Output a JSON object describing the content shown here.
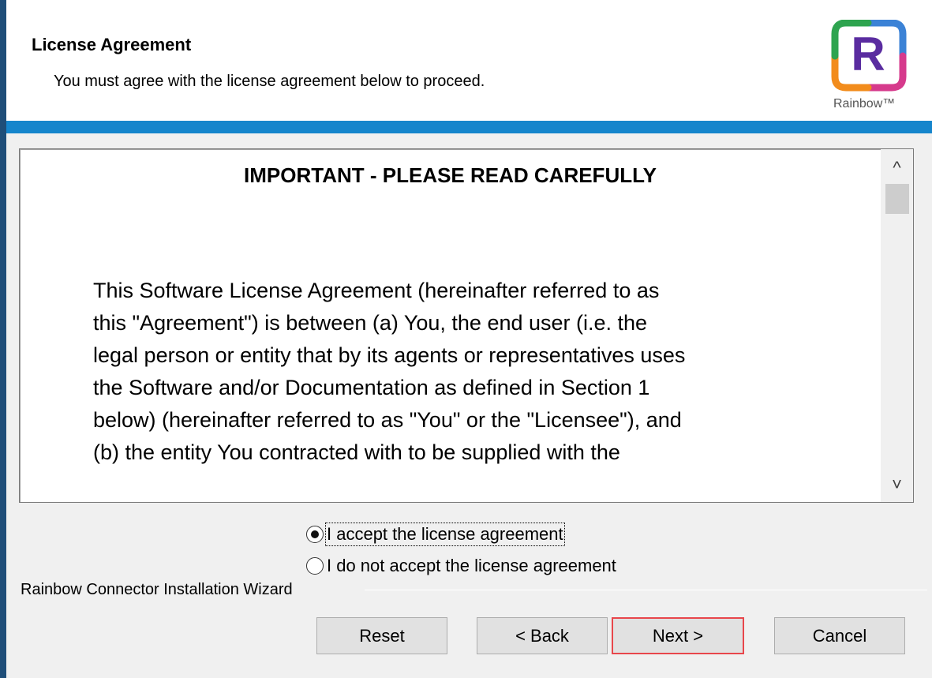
{
  "header": {
    "title": "License Agreement",
    "subtitle": "You must agree with the license agreement below to proceed.",
    "logo_letter": "R",
    "logo_caption": "Rainbow™"
  },
  "license": {
    "heading": "IMPORTANT - PLEASE READ CAREFULLY",
    "body": "This Software License Agreement (hereinafter referred to as\nthis \"Agreement\") is between (a) You, the end user (i.e. the\nlegal person or entity that by its agents or representatives uses\nthe Software and/or Documentation as defined in Section 1\nbelow) (hereinafter referred to as \"You\" or the \"Licensee\"), and\n(b) the entity You contracted with to be supplied with the"
  },
  "scrollbar": {
    "up_glyph": "^",
    "down_glyph": "˅"
  },
  "options": {
    "accept_label": "I accept the license agreement",
    "decline_label": "I do not accept the license agreement",
    "selected": "accept"
  },
  "footer": {
    "group_title": "Rainbow Connector Installation Wizard",
    "reset_label": "Reset",
    "back_label": "< Back",
    "next_label": "Next >",
    "cancel_label": "Cancel"
  },
  "colors": {
    "blue_bar": "#1585cc",
    "logo_purple": "#5a2ca0",
    "default_button_border": "#e8464b"
  }
}
